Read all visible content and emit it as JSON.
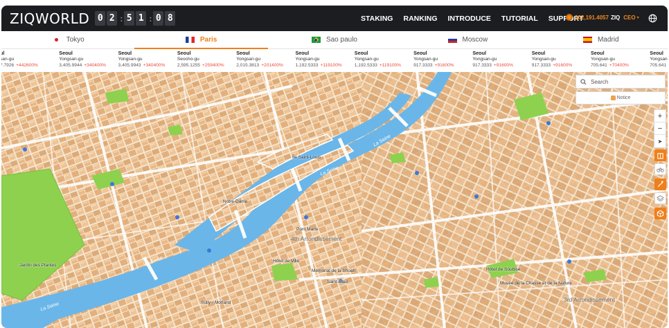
{
  "header": {
    "logo": "ZIQWORLD",
    "timer": [
      "0",
      "2",
      "5",
      "1",
      "0",
      "8"
    ],
    "nav": [
      "STAKING",
      "RANKING",
      "INTRODUCE",
      "TUTORIAL",
      "SUPPORT"
    ],
    "balance_value": "202,191.4057",
    "balance_unit": "ZIQ",
    "rank": "CEO",
    "rank_caret": "▾",
    "globe_icon": "globe-icon"
  },
  "city_tabs": [
    {
      "label": "Tokyo",
      "flag": "japan"
    },
    {
      "label": "Paris",
      "flag": "france",
      "active": true
    },
    {
      "label": "Sao paulo",
      "flag": "brazil"
    },
    {
      "label": "Moscow",
      "flag": "russia"
    },
    {
      "label": "Madrid",
      "flag": "spain"
    }
  ],
  "ticker": [
    {
      "city": "ul",
      "district": "san-gu",
      "price": "7.7926",
      "change": "+442600%"
    },
    {
      "city": "Seoul",
      "district": "Yongsan-gu",
      "price": "3,405.9944",
      "change": "+340400%"
    },
    {
      "city": "Seoul",
      "district": "Yongsan-gu",
      "price": "3,405.9943",
      "change": "+340400%"
    },
    {
      "city": "Seoul",
      "district": "Seocho-gu",
      "price": "2,595.1255",
      "change": "+259400%"
    },
    {
      "city": "Seoul",
      "district": "Yongsan-gu",
      "price": "2,015.3813",
      "change": "+201400%"
    },
    {
      "city": "Seoul",
      "district": "Yongsan-gu",
      "price": "1,192.5333",
      "change": "+119100%"
    },
    {
      "city": "Seoul",
      "district": "Yongsan-gu",
      "price": "1,192.5333",
      "change": "+119100%"
    },
    {
      "city": "Seoul",
      "district": "Yongsan-gu",
      "price": "917.3333",
      "change": "+91600%"
    },
    {
      "city": "Seoul",
      "district": "Yongsan-gu",
      "price": "917.3333",
      "change": "+91600%"
    },
    {
      "city": "Seoul",
      "district": "Yongsan-gu",
      "price": "917.3333",
      "change": "+91600%"
    },
    {
      "city": "Seoul",
      "district": "Yongsan-gu",
      "price": "705.641",
      "change": "+70400%"
    },
    {
      "city": "Seoul",
      "district": "Yongsan-gu",
      "price": "705.641",
      "change": ""
    }
  ],
  "map": {
    "labels": {
      "arr4": "4th Arrondissement",
      "arr3": "3rd Arrondissement",
      "seine1": "La Seine",
      "seine2": "La Seine",
      "seine3": "La Seine",
      "seine4": "La Seine",
      "pont_marie": "Pont Marie",
      "hotel_de_ville": "Hôtel de Ville",
      "musee": "Mémorial de la Shoah",
      "sully": "Sully - Morland",
      "saint_paul": "Saint-Paul",
      "jardin": "Jardin des Plantes",
      "hotel_soubise": "Hôtel de Soubise",
      "musee_chasse": "Musée de la Chasse et de la Nature",
      "notre_dame": "Notre-Dame",
      "ile": "Île Saint-Louis"
    }
  },
  "controls": {
    "search_placeholder": "Search",
    "notice_label": "Notice",
    "zoom_in": "+",
    "zoom_out": "−",
    "compass": "➤"
  }
}
